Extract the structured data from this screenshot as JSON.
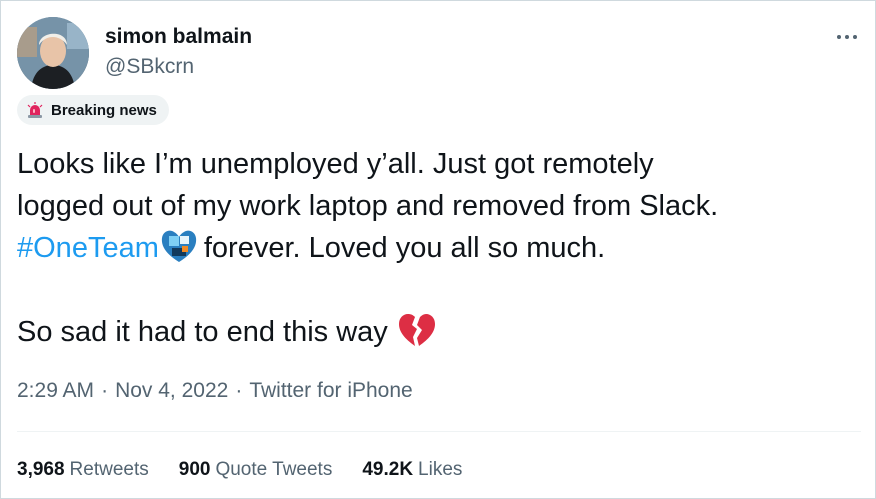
{
  "author": {
    "display_name": "simon balmain",
    "handle": "@SBkcrn",
    "avatar_icon": "profile-photo"
  },
  "badge": {
    "icon": "police-light-icon",
    "label": "Breaking news"
  },
  "tweet": {
    "line1": "Looks like I’m unemployed y’all. Just got remotely",
    "line2": "logged out of my work laptop and removed from Slack.",
    "hashtag": "#OneTeam",
    "hashtag_emoji": "oneteam-hashflag-icon",
    "line3_rest": "forever. Loved you all so much.",
    "line4": "So sad it had to end this way",
    "end_emoji": "broken-heart-icon"
  },
  "meta": {
    "time": "2:29 AM",
    "separator": "·",
    "date": "Nov 4, 2022",
    "source": "Twitter for iPhone"
  },
  "stats": {
    "retweets_count": "3,968",
    "retweets_label": "Retweets",
    "quotes_count": "900",
    "quotes_label": "Quote Tweets",
    "likes_count": "49.2K",
    "likes_label": "Likes"
  },
  "colors": {
    "link": "#1d9bf0",
    "text": "#0f1419",
    "muted": "#536471",
    "border": "#cfd9de"
  }
}
